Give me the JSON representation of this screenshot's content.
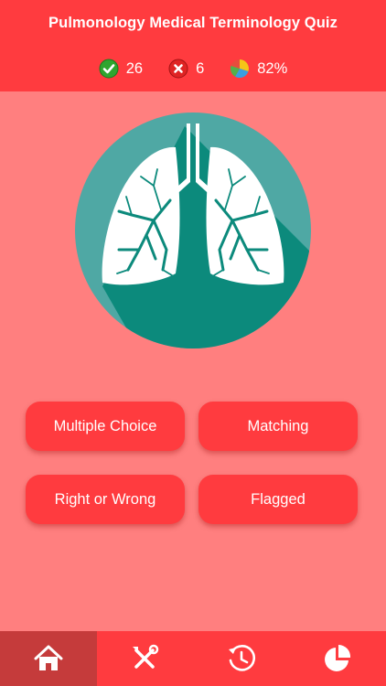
{
  "header": {
    "title": "Pulmonology Medical Terminology Quiz",
    "stats": {
      "correct": "26",
      "wrong": "6",
      "score": "82%"
    }
  },
  "hero": {
    "icon": "lungs-icon"
  },
  "modes": {
    "multiple_choice": "Multiple Choice",
    "matching": "Matching",
    "right_or_wrong": "Right or Wrong",
    "flagged": "Flagged"
  },
  "tabs": [
    {
      "icon": "home-icon",
      "active": true
    },
    {
      "icon": "tools-icon",
      "active": false
    },
    {
      "icon": "history-icon",
      "active": false
    },
    {
      "icon": "pie-chart-icon",
      "active": false
    }
  ],
  "colors": {
    "background": "#ff7f7f",
    "header": "#ff3b3f",
    "button": "#ff3b3f",
    "active_tab": "#c53b3b",
    "hero_circle": "#4fa8a4",
    "hero_shadow": "#0c8a7c"
  }
}
